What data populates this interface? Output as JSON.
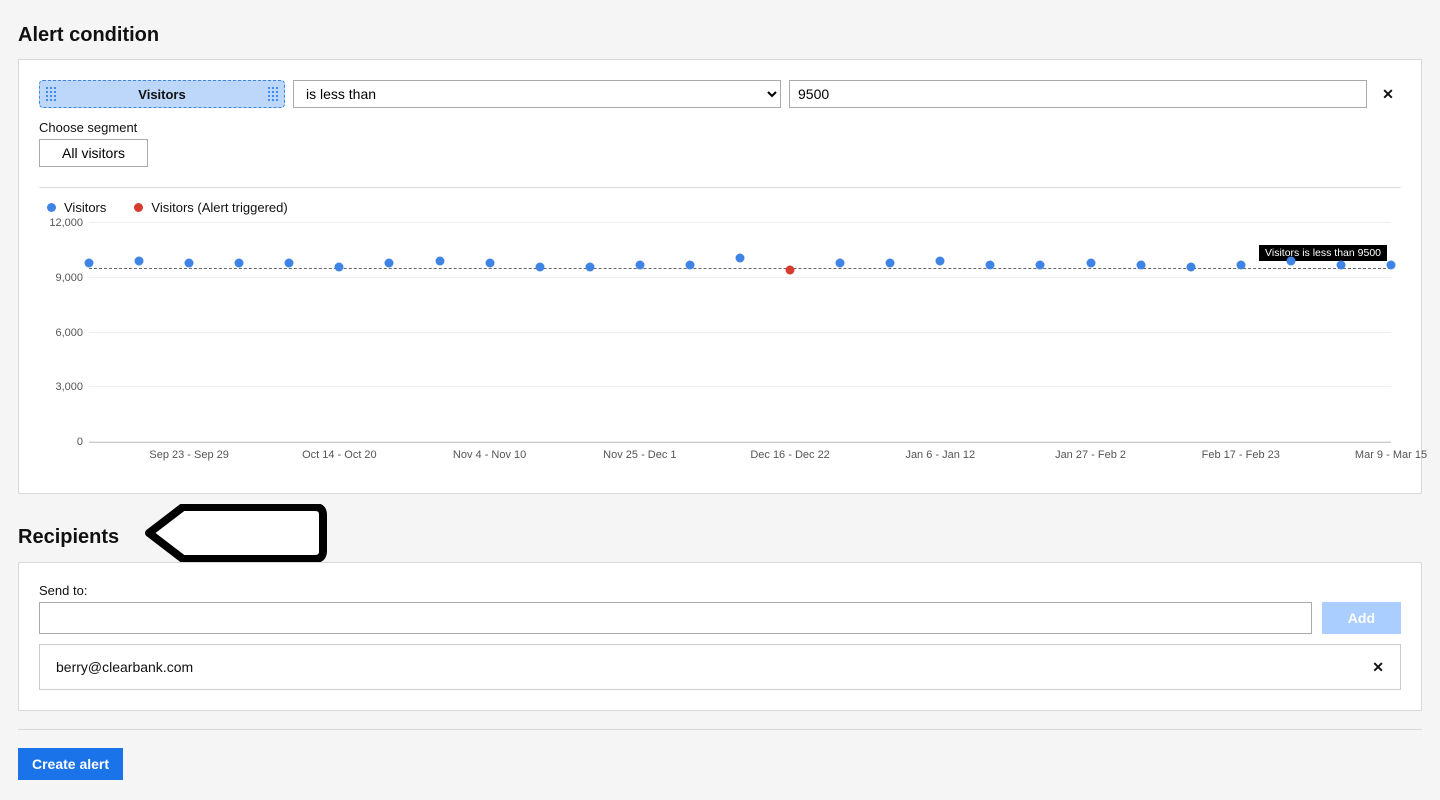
{
  "alert_condition": {
    "title": "Alert condition",
    "metric_label": "Visitors",
    "condition_options": [
      "is less than"
    ],
    "condition_selected": "is less than",
    "threshold_value": "9500",
    "choose_segment_label": "Choose segment",
    "segment_button": "All visitors",
    "legend": {
      "series_a": "Visitors",
      "series_b": "Visitors (Alert triggered)",
      "color_a": "#3f84e5",
      "color_b": "#d83a2f"
    },
    "threshold_tag": "Visitors is less than 9500"
  },
  "chart_data": {
    "type": "scatter",
    "title": "",
    "xlabel": "",
    "ylabel": "",
    "ylim": [
      0,
      12000
    ],
    "y_ticks": [
      0,
      3000,
      6000,
      9000,
      12000
    ],
    "y_tick_labels": [
      "0",
      "3,000",
      "6,000",
      "9,000",
      "12,000"
    ],
    "threshold": 9500,
    "x_tick_positions": [
      3,
      6,
      9,
      12,
      15,
      18,
      21,
      24,
      27
    ],
    "x_tick_labels": [
      "Sep 23 - Sep 29",
      "Oct 14 - Oct 20",
      "Nov 4 - Nov 10",
      "Nov 25 - Dec 1",
      "Dec 16 - Dec 22",
      "Jan 6 - Jan 12",
      "Jan 27 - Feb 2",
      "Feb 17 - Feb 23",
      "Mar 9 - Mar 15"
    ],
    "series": [
      {
        "name": "Visitors",
        "color": "#3f84e5",
        "x": [
          1,
          2,
          3,
          4,
          5,
          6,
          7,
          8,
          9,
          10,
          11,
          12,
          13,
          14,
          16,
          17,
          18,
          19,
          20,
          21,
          22,
          23,
          24,
          25,
          26,
          27
        ],
        "values": [
          9800,
          9900,
          9800,
          9800,
          9800,
          9600,
          9800,
          9900,
          9800,
          9600,
          9600,
          9700,
          9700,
          10100,
          9800,
          9800,
          9900,
          9700,
          9700,
          9800,
          9700,
          9600,
          9700,
          9900,
          9700,
          9700
        ]
      },
      {
        "name": "Visitors (Alert triggered)",
        "color": "#d83a2f",
        "x": [
          15
        ],
        "values": [
          9450
        ]
      }
    ]
  },
  "recipients": {
    "title": "Recipients",
    "send_to_label": "Send to:",
    "send_to_value": "",
    "add_button": "Add",
    "items": [
      {
        "email": "berry@clearbank.com"
      }
    ]
  },
  "actions": {
    "create": "Create alert"
  }
}
